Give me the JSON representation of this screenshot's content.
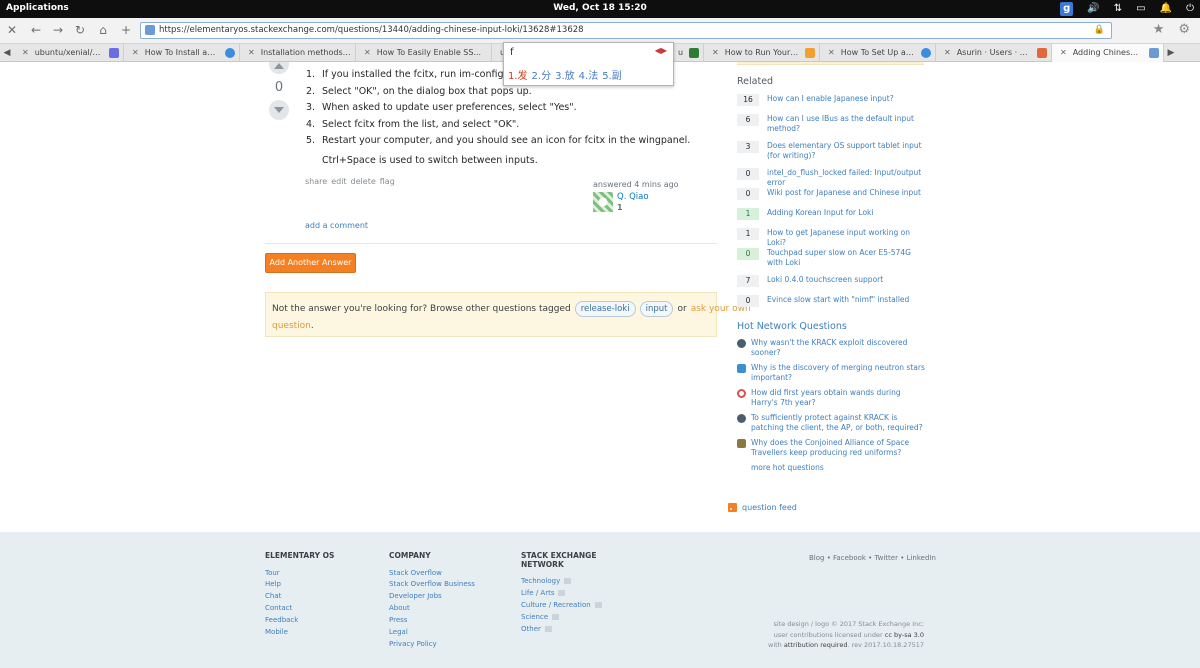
{
  "os_panel": {
    "apps": "Applications",
    "clock": "Wed, Oct 18   15:20",
    "tray_g": "g"
  },
  "browser": {
    "url": "https://elementaryos.stackexchange.com/questions/13440/adding-chinese-input-loki/13628#13628",
    "tabs": [
      {
        "title": "ubuntu/xenial/gitlab-...",
        "fav_color": "#6a6ee0"
      },
      {
        "title": "How To Install and C...",
        "fav_color": "#3a8de0"
      },
      {
        "title": "Installation methods for...",
        "fav_color": "#dddddd"
      },
      {
        "title": "How To Easily Enable SS...",
        "fav_color": "#dddddd"
      },
      {
        "title": "u",
        "fav_color": "#dddddd"
      },
      {
        "title": "ubu...",
        "fav_color": "#2e7d32"
      },
      {
        "title": "How to Run Your Ow...",
        "fav_color": "#f4a030"
      },
      {
        "title": "How To Set Up a Priv...",
        "fav_color": "#3a8de0"
      },
      {
        "title": "Asurin · Users · Admi...",
        "fav_color": "#e2683c"
      },
      {
        "title": "Adding Chinese Input...",
        "fav_color": "#6b9ad6"
      }
    ]
  },
  "ime": {
    "input": "f",
    "candidates": [
      {
        "num": "1.",
        "ch": "发"
      },
      {
        "num": "2.",
        "ch": "分"
      },
      {
        "num": "3.",
        "ch": "放"
      },
      {
        "num": "4.",
        "ch": "法"
      },
      {
        "num": "5.",
        "ch": "副"
      }
    ]
  },
  "answer": {
    "vote_count": "0",
    "steps": [
      {
        "n": "1.",
        "text": "If you installed the fcitx, run im-config in your terminal."
      },
      {
        "n": "2.",
        "text": "Select \"OK\", on the dialog box that pops up."
      },
      {
        "n": "3.",
        "text": "When asked to update user preferences, select \"Yes\"."
      },
      {
        "n": "4.",
        "text": "Select fcitx from the list, and select \"OK\"."
      },
      {
        "n": "5.",
        "text": "Restart your computer, and you should see an icon for fcitx in the wingpanel."
      }
    ],
    "note": "Ctrl+Space is used to switch between inputs.",
    "menu": [
      "share",
      "edit",
      "delete",
      "flag"
    ],
    "answered": "answered 4 mins ago",
    "user": "Q. Qiao",
    "rep": "1",
    "add_comment": "add a comment"
  },
  "add_another_answer": "Add Another Answer",
  "notice": {
    "text": "Not the answer you're looking for? Browse other questions tagged",
    "tags": [
      "release-loki",
      "input"
    ],
    "or": "or",
    "ask": "ask your own",
    "ask2": "question",
    "dot": "."
  },
  "sidebar": {
    "related_heading": "Related",
    "related": [
      {
        "count": "16",
        "accepted": false,
        "title": "How can I enable Japanese input?"
      },
      {
        "count": "6",
        "accepted": false,
        "title": "How can I use IBus as the default input method?"
      },
      {
        "count": "3",
        "accepted": false,
        "title": "Does elementary OS support tablet input (for writing)?"
      },
      {
        "count": "0",
        "accepted": false,
        "title": "intel_do_flush_locked failed: Input/output error"
      },
      {
        "count": "0",
        "accepted": false,
        "title": "Wiki post for Japanese and Chinese input"
      },
      {
        "count": "1",
        "accepted": true,
        "title": "Adding Korean Input for Loki"
      },
      {
        "count": "1",
        "accepted": false,
        "title": "How to get Japanese input working on Loki?"
      },
      {
        "count": "0",
        "accepted": true,
        "title": "Touchpad super slow on Acer E5-574G with Loki"
      },
      {
        "count": "7",
        "accepted": false,
        "title": "Loki 0.4.0 touchscreen support"
      },
      {
        "count": "0",
        "accepted": false,
        "title": "Evince slow start with \"nimf\" installed"
      }
    ],
    "hnq_heading": "Hot Network Questions",
    "hnq": [
      {
        "title": "Why wasn't the KRACK exploit discovered sooner?",
        "icon_color": "#4a5d6e"
      },
      {
        "title": "Why is the discovery of merging neutron stars important?",
        "icon_color": "#3b8fd4"
      },
      {
        "title": "How did first years obtain wands during Harry's 7th year?",
        "icon_color": "#d4564a"
      },
      {
        "title": "To sufficiently protect against KRACK is patching the client, the AP, or both, required?",
        "icon_color": "#4a5d6e"
      },
      {
        "title": "Why does the Conjoined Alliance of Space Travellers keep producing red uniforms?",
        "icon_color": "#8b7a3e"
      }
    ],
    "more_hot": "more hot questions",
    "question_feed": "question feed"
  },
  "footer": {
    "col1": {
      "heading": "ELEMENTARY OS",
      "links": [
        "Tour",
        "Help",
        "Chat",
        "Contact",
        "Feedback",
        "Mobile"
      ]
    },
    "col2": {
      "heading": "COMPANY",
      "links": [
        "Stack Overflow",
        "Stack Overflow Business",
        "Developer Jobs",
        "About",
        "Press",
        "Legal",
        "Privacy Policy"
      ]
    },
    "col3": {
      "heading": "STACK EXCHANGE NETWORK",
      "links": [
        "Technology",
        "Life / Arts",
        "Culture / Recreation",
        "Science",
        "Other"
      ]
    },
    "social": "Blog • Facebook • Twitter • LinkedIn",
    "copyright": {
      "line1": "site design / logo © 2017 Stack Exchange Inc;",
      "line2": "user contributions licensed under",
      "license": "cc by-sa 3.0",
      "line3a": "with",
      "attr": "attribution required",
      "line3b": ". rev 2017.10.18.27517"
    }
  }
}
